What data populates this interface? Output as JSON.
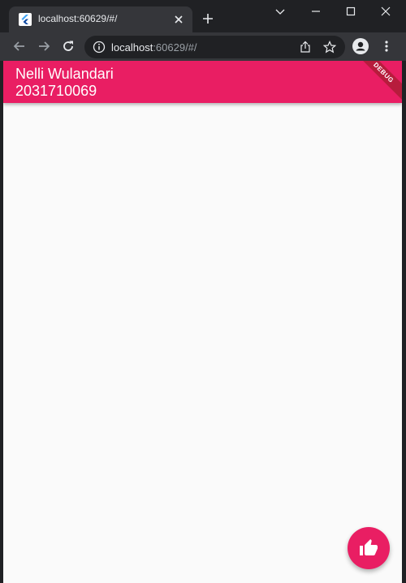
{
  "browser": {
    "tab_title": "localhost:60629/#/",
    "url_host": "localhost",
    "url_rest": ":60629/#/",
    "icons": [
      "flutter-favicon",
      "close-icon",
      "plus-icon",
      "chevron-down-icon",
      "minimize-icon",
      "maximize-icon",
      "close-window-icon",
      "back-arrow-icon",
      "forward-arrow-icon",
      "reload-icon",
      "info-icon",
      "share-icon",
      "star-icon",
      "profile-icon",
      "more-vert-icon"
    ]
  },
  "app": {
    "appbar": {
      "name": "Nelli Wulandari",
      "id": "2031710069",
      "color": "#e91e63"
    },
    "debug_banner": "DEBUG",
    "fab": {
      "icon": "thumb-up-icon",
      "color": "#e91e63"
    }
  }
}
